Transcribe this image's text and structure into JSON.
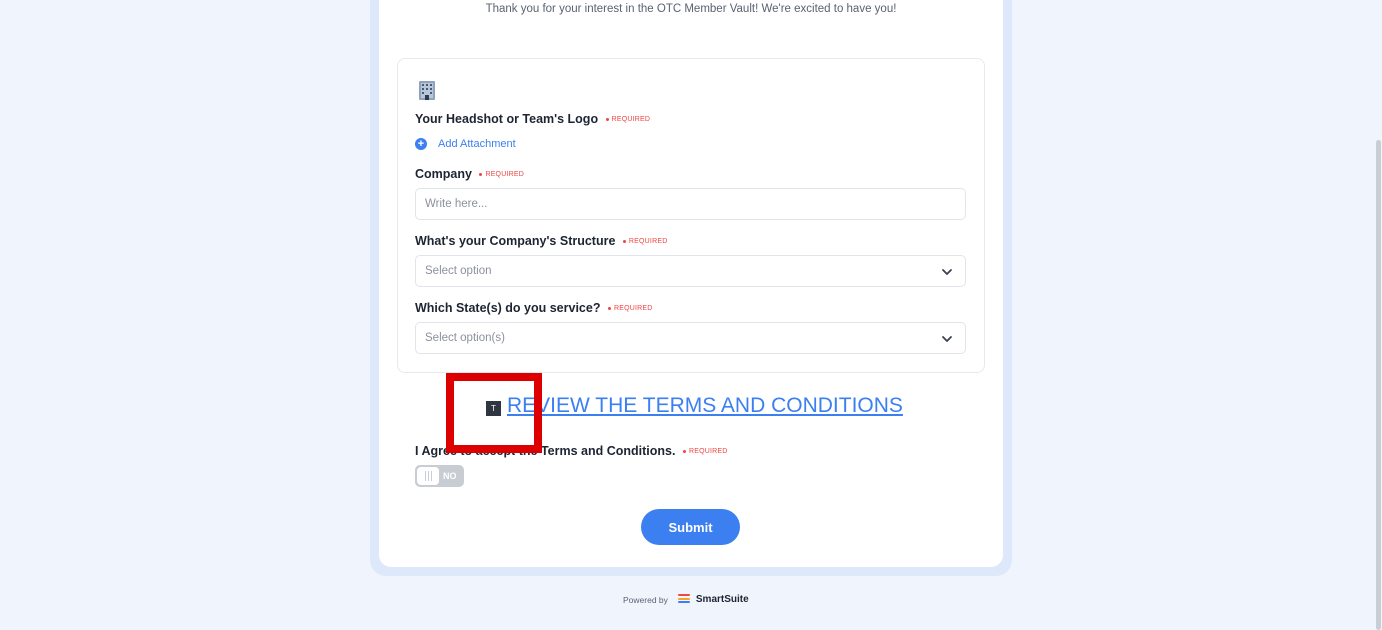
{
  "intro_text": "Thank you for your interest in the OTC Member Vault! We're excited to have you!",
  "required_label": "REQUIRED",
  "fields": {
    "headshot": {
      "label": "Your Headshot or Team's Logo",
      "action": "Add Attachment"
    },
    "company": {
      "label": "Company",
      "placeholder": "Write here..."
    },
    "structure": {
      "label": "What's your Company's Structure",
      "placeholder": "Select option"
    },
    "states": {
      "label": "Which State(s) do you service?",
      "placeholder": "Select option(s)"
    }
  },
  "terms": {
    "badge": "T",
    "link_text": "REVIEW THE TERMS AND CONDITIONS",
    "agree_label": "I Agree to accept the Terms and Conditions.",
    "toggle_value": "NO"
  },
  "submit_label": "Submit",
  "footer": {
    "powered_by": "Powered by",
    "brand": "SmartSuite"
  },
  "colors": {
    "accent": "#3b7ff0",
    "required": "#ef4444",
    "highlight": "#dd0000",
    "logo": [
      "#e94b3c",
      "#f5a623",
      "#3b7ff0"
    ]
  }
}
